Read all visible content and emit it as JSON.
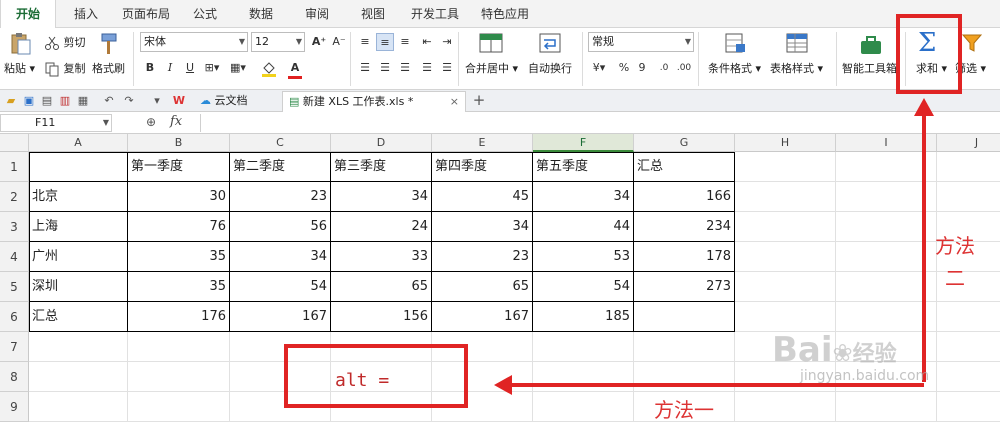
{
  "ribbon_tabs": [
    "开始",
    "插入",
    "页面布局",
    "公式",
    "数据",
    "审阅",
    "视图",
    "开发工具",
    "特色应用"
  ],
  "ribbon": {
    "paste": "粘贴",
    "cut": "剪切",
    "copy": "复制",
    "format_painter": "格式刷",
    "font_name": "宋体",
    "font_size": "12",
    "bold": "B",
    "italic": "I",
    "underline": "U",
    "font_color_letter": "A",
    "merge_center": "合并居中",
    "wrap_text": "自动换行",
    "number_format": "常规",
    "percent": "%",
    "comma": "9",
    "conditional_format": "条件格式",
    "table_style": "表格样式",
    "smart_toolbox": "智能工具箱",
    "sum_symbol": "Σ",
    "sum": "求和",
    "filter": "筛选"
  },
  "doc_tabs": {
    "cloud_docs": "云文档",
    "active_file": "新建 XLS 工作表.xls *",
    "close_symbol": "×",
    "add_symbol": "+"
  },
  "formula_bar": {
    "name_box": "F11",
    "fx_label": "fx",
    "zoom_icon": "⊕"
  },
  "sheet": {
    "columns": [
      "A",
      "B",
      "C",
      "D",
      "E",
      "F",
      "G",
      "H",
      "I",
      "J"
    ],
    "selected_column": "F",
    "rows": [
      "1",
      "2",
      "3",
      "4",
      "5",
      "6",
      "7",
      "8",
      "9"
    ],
    "table": [
      [
        "",
        "第一季度",
        "第二季度",
        "第三季度",
        "第四季度",
        "第五季度",
        "汇总"
      ],
      [
        "北京",
        "30",
        "23",
        "34",
        "45",
        "34",
        "166"
      ],
      [
        "上海",
        "76",
        "56",
        "24",
        "34",
        "44",
        "234"
      ],
      [
        "广州",
        "35",
        "34",
        "33",
        "23",
        "53",
        "178"
      ],
      [
        "深圳",
        "35",
        "54",
        "65",
        "65",
        "54",
        "273"
      ],
      [
        "汇总",
        "176",
        "167",
        "156",
        "167",
        "185",
        ""
      ]
    ]
  },
  "annotations": {
    "method_one": "方法一",
    "method_two_line1": "方法",
    "method_two_line2": "二",
    "shortcut": "alt =",
    "color": "#e02424"
  },
  "watermark": {
    "brand": "Bai",
    "brand_cn": "经验",
    "url": "jingyan.baidu.com"
  }
}
